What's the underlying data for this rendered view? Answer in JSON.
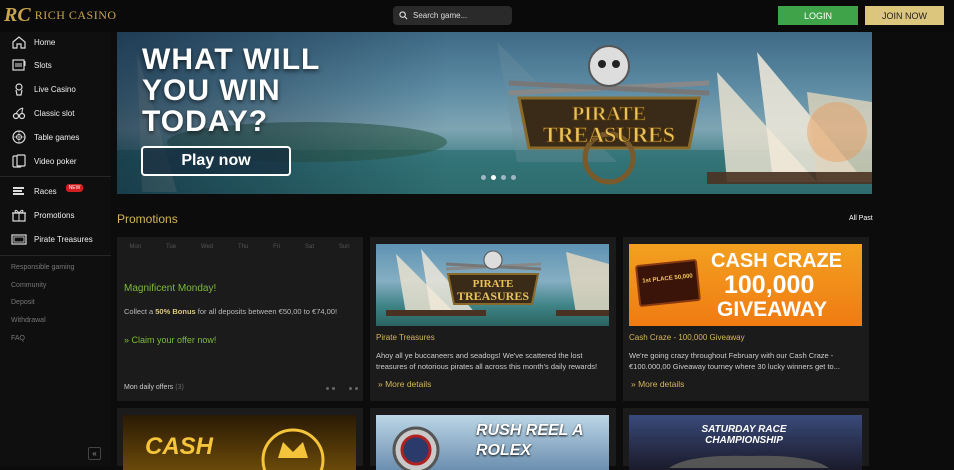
{
  "header": {
    "logo_mark": "RC",
    "logo_text": "RICH CASINO",
    "search_placeholder": "Search game...",
    "login_label": "LOGIN",
    "join_label": "JOIN NOW"
  },
  "sidebar": {
    "items": [
      {
        "label": "Home",
        "icon": "home-icon"
      },
      {
        "label": "Slots",
        "icon": "slot-machine-icon"
      },
      {
        "label": "Live Casino",
        "icon": "dealer-icon"
      },
      {
        "label": "Classic slot",
        "icon": "cherry-icon"
      },
      {
        "label": "Table games",
        "icon": "roulette-icon"
      },
      {
        "label": "Video poker",
        "icon": "cards-icon"
      },
      {
        "label": "Races",
        "icon": "races-icon",
        "badge": "NEW"
      },
      {
        "label": "Promotions",
        "icon": "gift-icon"
      },
      {
        "label": "Pirate Treasures",
        "icon": "treasure-icon"
      }
    ],
    "links": [
      "Responsible gaming",
      "Community",
      "Deposit",
      "Withdrawal",
      "FAQ"
    ],
    "collapse_label": "«"
  },
  "banner": {
    "headline": "WHAT WILL YOU WIN TODAY?",
    "cta": "Play now",
    "game_logo": "PIRATE TREASURES",
    "slides": 4,
    "active_slide": 2
  },
  "promotions": {
    "title": "Promotions",
    "all_past": "All Past",
    "weekdays": [
      "Mon",
      "Tue",
      "Wed",
      "Thu",
      "Fri",
      "Sat",
      "Sun"
    ],
    "featured": {
      "heading": "Magnificent Monday!",
      "body_prefix": "Collect a ",
      "body_bonus": "50% Bonus",
      "body_suffix": " for all deposits between €50,00 to €74,00!",
      "claim": "» Claim your offer now!",
      "footer_label": "Mon daily offers",
      "footer_count": "(3)"
    },
    "cards": [
      {
        "image_text": "PIRATE TREASURES",
        "title": "Pirate Treasures",
        "text": "Ahoy all ye buccaneers and seadogs! We've scattered the lost treasures of notorious pirates all across this month's daily rewards!",
        "more": "» More details"
      },
      {
        "image_text": "CASH CRAZE 100,000 GIVEAWAY",
        "image_line1": "CASH CRAZE",
        "image_line2": "100,000",
        "image_line3": "GIVEAWAY",
        "image_tag": "1st PLACE 50,000",
        "title": "Cash Craze - 100,000 Giveaway",
        "text": "We're going crazy throughout February with our Cash Craze - €100.000,00 Giveaway tourney where 30 lucky winners get to...",
        "more": "» More details"
      }
    ],
    "bottom_cards": [
      {
        "image_text": "CASH"
      },
      {
        "image_text": "RUSH REEL A ROLEX"
      },
      {
        "image_text": "SATURDAY RACE CHAMPIONSHIP"
      }
    ]
  },
  "colors": {
    "gold": "#d6b55a",
    "green_button": "#3fa34a",
    "join_button": "#dcc57c",
    "promo_green": "#7cba3c",
    "new_badge": "#d21e1e"
  }
}
